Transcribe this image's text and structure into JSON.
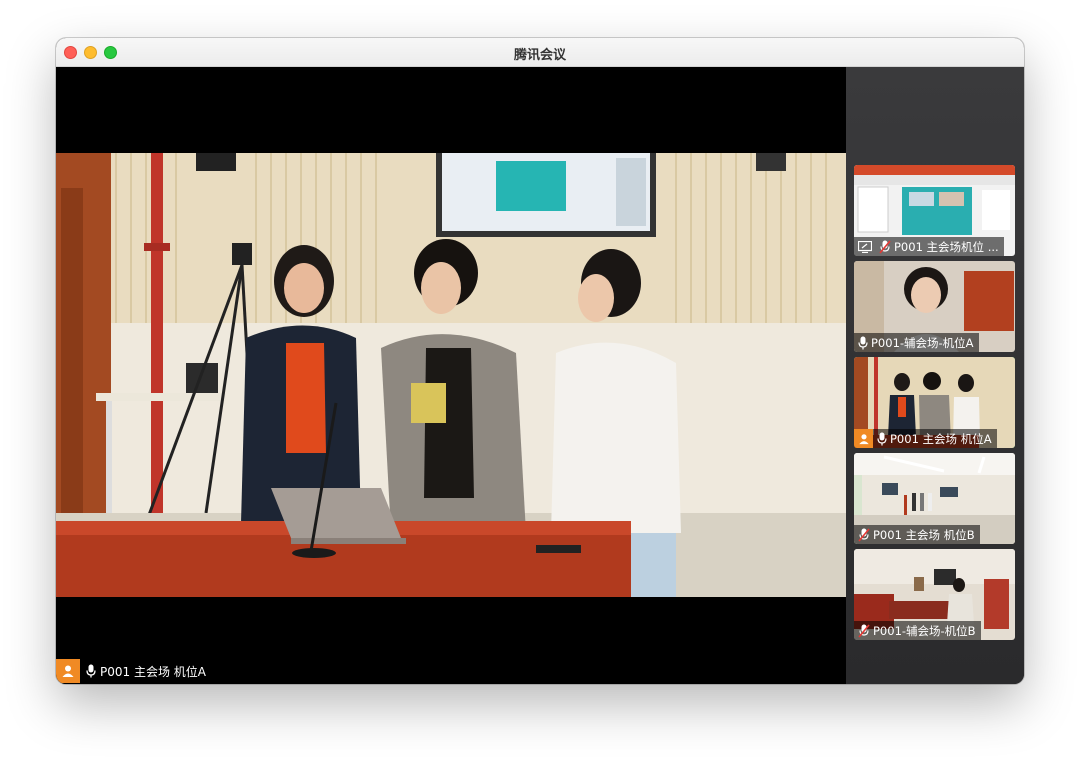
{
  "window": {
    "title": "腾讯会议"
  },
  "main": {
    "speaker_label": "P001 主会场 机位A"
  },
  "sidebar": {
    "tiles": [
      {
        "label": "P001 主会场机位 ...",
        "status": "screen-share",
        "mic": "muted",
        "active": false
      },
      {
        "label": "P001-辅会场-机位A",
        "status": "none",
        "mic": "on",
        "active": false
      },
      {
        "label": "P001 主会场 机位A",
        "status": "speaking",
        "mic": "on",
        "active": true
      },
      {
        "label": "P001 主会场 机位B",
        "status": "none",
        "mic": "muted",
        "active": false
      },
      {
        "label": "P001-辅会场-机位B",
        "status": "none",
        "mic": "muted",
        "active": false
      }
    ]
  },
  "colors": {
    "active_border": "#2ecc71",
    "badge": "#f08a24",
    "sidebar_bg": "#333335"
  }
}
